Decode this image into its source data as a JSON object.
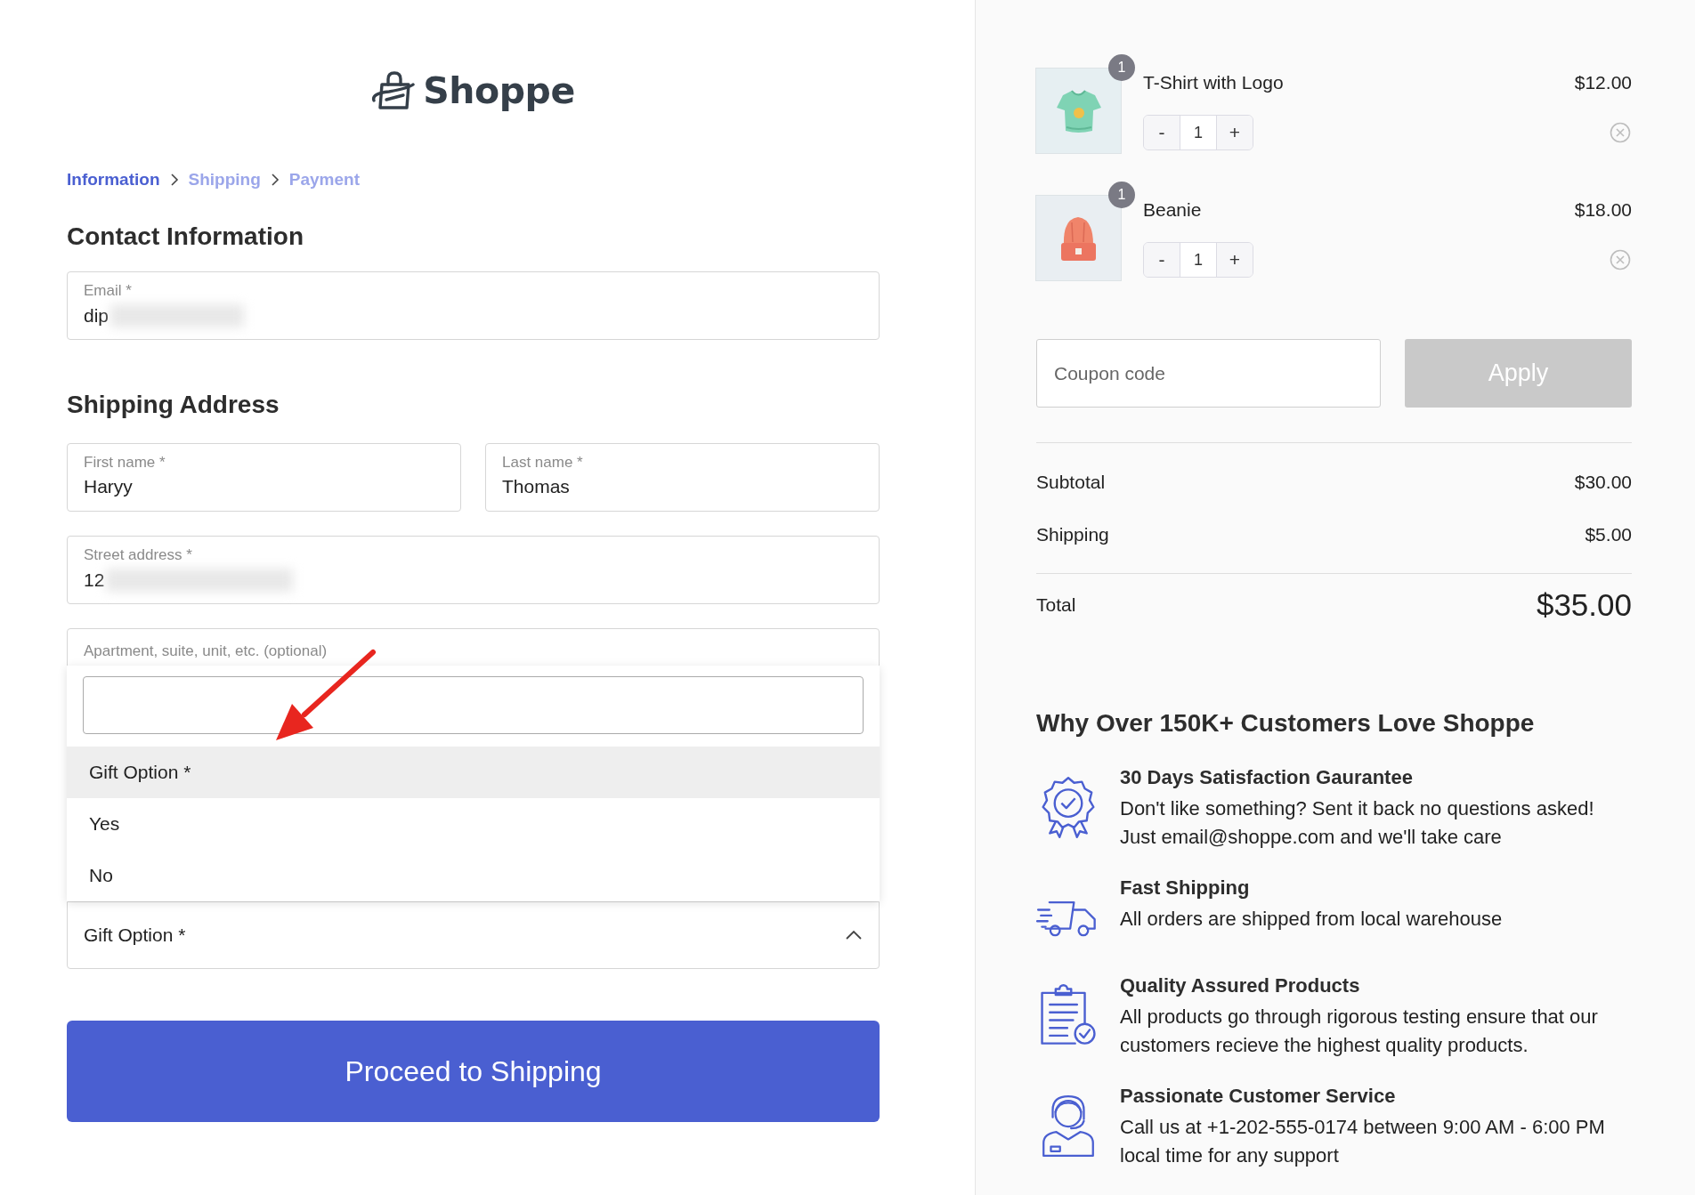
{
  "logo": {
    "text": "Shoppe"
  },
  "breadcrumb": [
    {
      "label": "Information",
      "selected": true
    },
    {
      "label": "Shipping",
      "selected": false
    },
    {
      "label": "Payment",
      "selected": false
    }
  ],
  "contact": {
    "heading": "Contact Information",
    "email": {
      "label": "Email *",
      "value": "dip",
      "redacted": true
    }
  },
  "shipping_address": {
    "heading": "Shipping Address",
    "first_name": {
      "label": "First name *",
      "value": "Haryy"
    },
    "last_name": {
      "label": "Last name *",
      "value": "Thomas"
    },
    "street": {
      "label": "Street address *",
      "value": "12",
      "redacted": true
    },
    "apartment": {
      "placeholder": "Apartment, suite, unit, etc. (optional)"
    }
  },
  "gift_option": {
    "label": "Gift Option *",
    "expanded": true,
    "options": [
      {
        "label": "Gift Option *",
        "selected": true
      },
      {
        "label": "Yes",
        "selected": false
      },
      {
        "label": "No",
        "selected": false
      }
    ]
  },
  "proceed_button": "Proceed to Shipping",
  "cart": {
    "items": [
      {
        "kind": "tshirt",
        "name": "T-Shirt with Logo",
        "price": "$12.00",
        "badge": "1",
        "quantity": "1",
        "decrement": "-",
        "increment": "+"
      },
      {
        "kind": "beanie",
        "name": "Beanie",
        "price": "$18.00",
        "badge": "1",
        "quantity": "1",
        "decrement": "-",
        "increment": "+"
      }
    ]
  },
  "coupon": {
    "placeholder": "Coupon code",
    "button": "Apply",
    "disabled": true
  },
  "summary": {
    "rows": [
      {
        "label": "Subtotal",
        "value": "$30.00"
      },
      {
        "label": "Shipping",
        "value": "$5.00"
      }
    ],
    "total": {
      "label": "Total",
      "value": "$35.00"
    }
  },
  "why": {
    "heading": "Why Over 150K+ Customers Love Shoppe",
    "features": [
      {
        "kind": "badge",
        "title": "30 Days Satisfaction Gaurantee",
        "text": "Don't like something? Sent it back no questions asked! Just email@shoppe.com and we'll take care"
      },
      {
        "kind": "truck",
        "title": "Fast Shipping",
        "text": "All orders are shipped from local warehouse"
      },
      {
        "kind": "clipboard",
        "title": "Quality Assured Products",
        "text": "All products go through rigorous testing ensure that our customers recieve the highest quality products."
      },
      {
        "kind": "agent",
        "title": "Passionate Customer Service",
        "text": "Call us at +1-202-555-0174 between 9:00 AM - 6:00 PM local time for any support"
      }
    ]
  }
}
